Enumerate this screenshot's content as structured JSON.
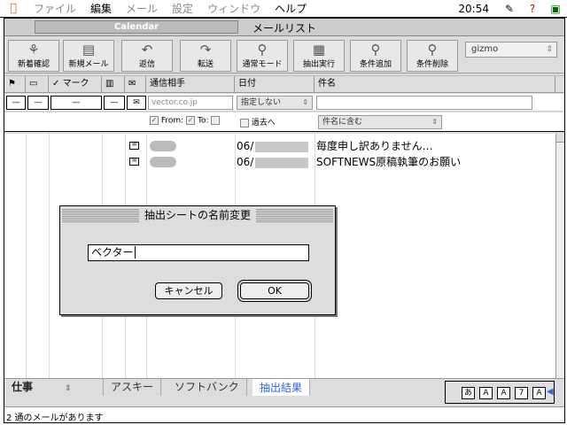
{
  "menubar": {
    "items": [
      "ファイル",
      "編集",
      "メール",
      "設定",
      "ウィンドウ",
      "ヘルプ"
    ],
    "clock": "20:54"
  },
  "window": {
    "tab_label": "Calendar",
    "title": "メールリスト"
  },
  "toolbar": {
    "buttons": [
      "新着確認",
      "新規メール",
      "返信",
      "転送",
      "通常モード",
      "抽出実行",
      "条件追加",
      "条件削除"
    ],
    "account": "gizmo"
  },
  "columns": {
    "mark": "マーク",
    "correspondent": "通信相手",
    "date": "日付",
    "subject": "件名"
  },
  "filter": {
    "dash": "—",
    "correspondent_value": "vector.co.jp",
    "date_select": "指定しない",
    "from_label": "From:",
    "to_label": "To:",
    "past_label": "過去へ",
    "subject_mode": "件名に含む"
  },
  "messages": [
    {
      "date": "06/",
      "subject": "毎度申し訳ありません…"
    },
    {
      "date": "06/",
      "subject": "SOFTNEWS原稿執筆のお願い"
    }
  ],
  "bottom_tabs": [
    "仕事",
    "アスキー",
    "ソフトバンク",
    "抽出結果"
  ],
  "status": "2 通のメールがあります",
  "dialog": {
    "title": "抽出シートの名前変更",
    "input_value": "ベクター",
    "cancel_label": "キャンセル",
    "ok_label": "OK"
  },
  "palette": {
    "labels": [
      "A",
      "A",
      "7",
      "A"
    ]
  }
}
